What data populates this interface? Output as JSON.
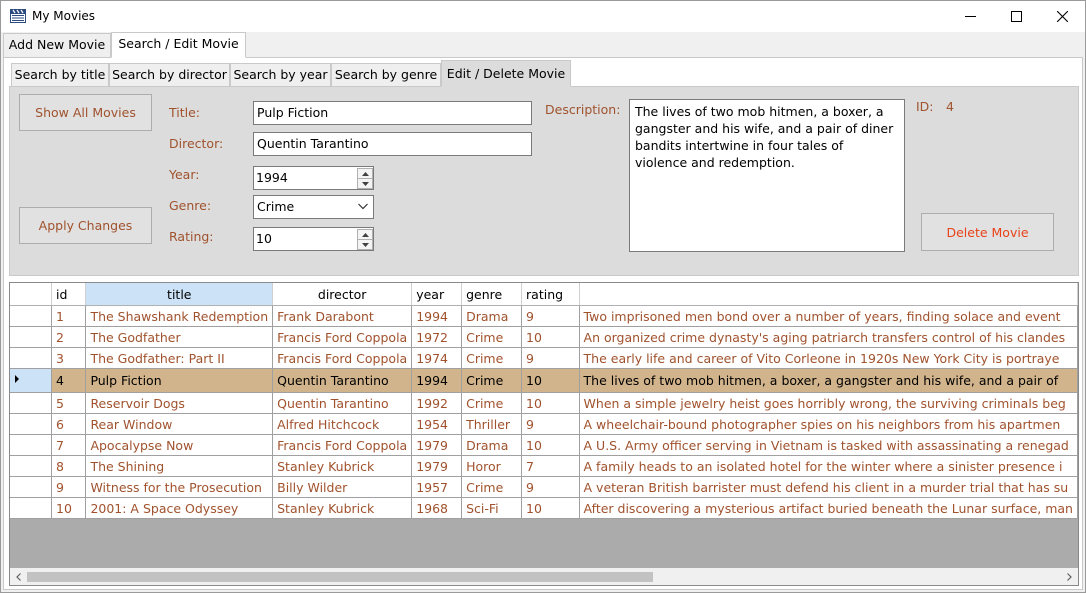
{
  "window": {
    "title": "My Movies",
    "icon": "clapperboard-icon"
  },
  "outer_tabs": [
    {
      "label": "Add New Movie",
      "active": false
    },
    {
      "label": "Search / Edit Movie",
      "active": true
    }
  ],
  "inner_tabs": [
    {
      "label": "Search by title",
      "active": false
    },
    {
      "label": "Search by director",
      "active": false
    },
    {
      "label": "Search by year",
      "active": false
    },
    {
      "label": "Search by genre",
      "active": false
    },
    {
      "label": "Edit / Delete Movie",
      "active": true
    }
  ],
  "form": {
    "show_all_label": "Show All Movies",
    "apply_label": "Apply Changes",
    "delete_label": "Delete Movie",
    "title_label": "Title:",
    "title_value": "Pulp Fiction",
    "director_label": "Director:",
    "director_value": "Quentin Tarantino",
    "year_label": "Year:",
    "year_value": "1994",
    "genre_label": "Genre:",
    "genre_value": "Crime",
    "rating_label": "Rating:",
    "rating_value": "10",
    "description_label": "Description:",
    "description_value": "The lives of two mob hitmen, a boxer, a gangster and his wife, and a pair of diner bandits intertwine in four tales of violence and redemption.",
    "id_label": "ID:",
    "id_value": "4"
  },
  "grid": {
    "columns": [
      "id",
      "title",
      "director",
      "year",
      "genre",
      "rating",
      ""
    ],
    "selected_column": "title",
    "selected_row": 3,
    "rows": [
      [
        "1",
        "The Shawshank Redemption",
        "Frank Darabont",
        "1994",
        "Drama",
        "9",
        "Two imprisoned men bond over a number of years, finding solace and event"
      ],
      [
        "2",
        "The Godfather",
        "Francis Ford Coppola",
        "1972",
        "Crime",
        "10",
        "An organized crime dynasty's aging patriarch transfers control of his clandes"
      ],
      [
        "3",
        "The Godfather: Part II",
        "Francis Ford Coppola",
        "1974",
        "Crime",
        "9",
        "The early life and career of Vito Corleone in 1920s New York City is portraye"
      ],
      [
        "4",
        "Pulp Fiction",
        "Quentin Tarantino",
        "1994",
        "Crime",
        "10",
        "The lives of two mob hitmen, a boxer, a gangster and his wife, and a pair of"
      ],
      [
        "5",
        "Reservoir Dogs",
        "Quentin Tarantino",
        "1992",
        "Crime",
        "10",
        "When a simple jewelry heist goes horribly wrong, the surviving criminals beg"
      ],
      [
        "6",
        "Rear Window",
        "Alfred Hitchcock",
        "1954",
        "Thriller",
        "9",
        "A wheelchair-bound photographer spies on his neighbors from his apartmen"
      ],
      [
        "7",
        "Apocalypse Now",
        "Francis Ford Coppola",
        "1979",
        "Drama",
        "10",
        "A U.S. Army officer serving in Vietnam is tasked with assassinating a renegad"
      ],
      [
        "8",
        "The Shining",
        "Stanley Kubrick",
        "1979",
        "Horor",
        "7",
        "A family heads to an isolated hotel for the winter where a sinister presence i"
      ],
      [
        "9",
        "Witness for the Prosecution",
        "Billy Wilder",
        "1957",
        "Crime",
        "9",
        "A veteran British barrister must defend his client in a murder trial that has su"
      ],
      [
        "10",
        "2001: A Space Odyssey",
        "Stanley Kubrick",
        "1968",
        "Sci-Fi",
        "10",
        "After discovering a mysterious artifact buried beneath the Lunar surface, man"
      ]
    ]
  },
  "colors": {
    "label_brown": "#a0522d",
    "selected_row": "#d2b48c",
    "selected_header": "#cce3f7",
    "delete_red": "#e8431a",
    "grid_empty": "#ababab"
  }
}
